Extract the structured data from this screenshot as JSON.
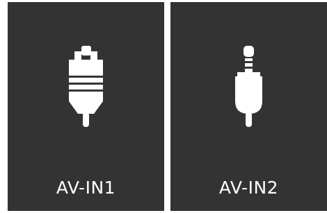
{
  "colors": {
    "tile_background": "#333333",
    "icon": "#ffffff",
    "label": "#ffffff"
  },
  "inputs": [
    {
      "label": "AV-IN1",
      "icon": "scart-connector-icon"
    },
    {
      "label": "AV-IN2",
      "icon": "rca-jack-connector-icon"
    }
  ]
}
